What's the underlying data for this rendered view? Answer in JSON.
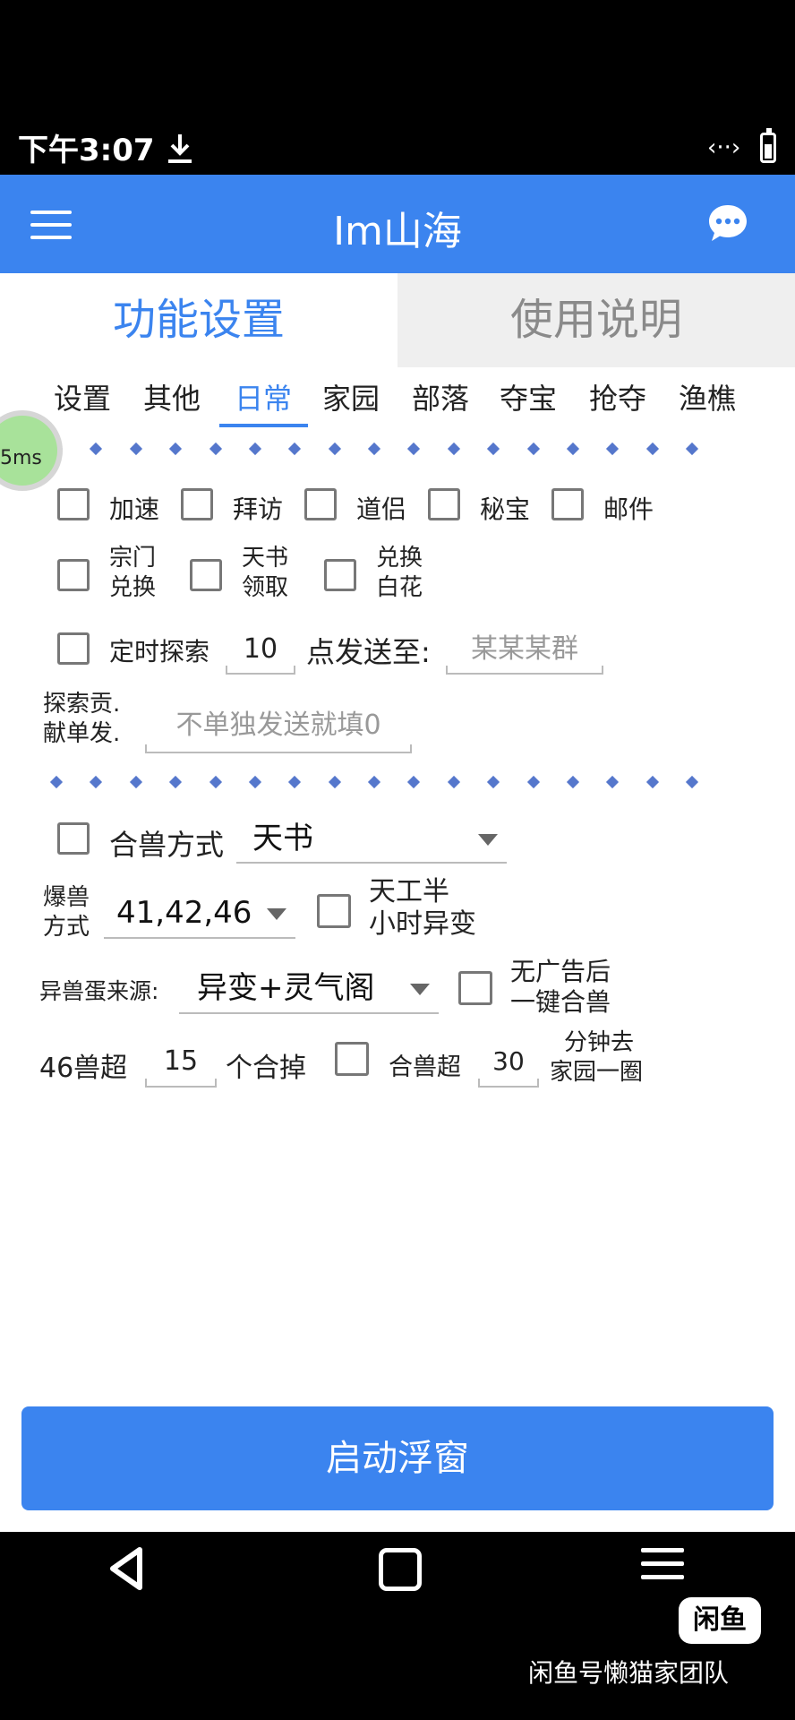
{
  "status_bar": {
    "time": "下午3:07",
    "link_glyph": "‹··›"
  },
  "app_bar": {
    "title": "Im山海"
  },
  "main_tabs": [
    "功能设置",
    "使用说明"
  ],
  "sub_tabs": [
    "设置",
    "其他",
    "日常",
    "家园",
    "部落",
    "夺宝",
    "抢夺",
    "渔樵"
  ],
  "selected_sub_tab": "日常",
  "floating_badge": "5ms",
  "checkboxes_row1": [
    "加速",
    "拜访",
    "道侣",
    "秘宝",
    "邮件"
  ],
  "checkboxes_row2": [
    {
      "line1": "宗门",
      "line2": "兑换"
    },
    {
      "line1": "天书",
      "line2": "领取"
    },
    {
      "line1": "兑换",
      "line2": "白花"
    }
  ],
  "timed_explore": {
    "label": "定时探索",
    "hour_value": "10",
    "send_label": "点发送至:",
    "group_hint": "某某某群"
  },
  "contribution": {
    "label_line1": "探索贡.",
    "label_line2": "献单发.",
    "hint": "不单独发送就填0"
  },
  "merge": {
    "label": "合兽方式",
    "selected": "天书"
  },
  "burst": {
    "label_line1": "爆兽",
    "label_line2": "方式",
    "selected": "41,42,46",
    "checkbox_line1": "天工半",
    "checkbox_line2": "小时异变"
  },
  "egg_source": {
    "label": "异兽蛋来源:",
    "selected": "异变+灵气阁",
    "checkbox_line1": "无广告后",
    "checkbox_line2": "一键合兽"
  },
  "beast_limit": {
    "prefix": "46兽超",
    "count": "15",
    "suffix": "个合掉",
    "checkbox_label": "合兽超",
    "minutes": "30",
    "tail_line1": "分钟去",
    "tail_line2": "家园一圈"
  },
  "start_button": "启动浮窗",
  "watermark": {
    "logo": "闲鱼",
    "text": "闲鱼号懒猫家团队"
  }
}
